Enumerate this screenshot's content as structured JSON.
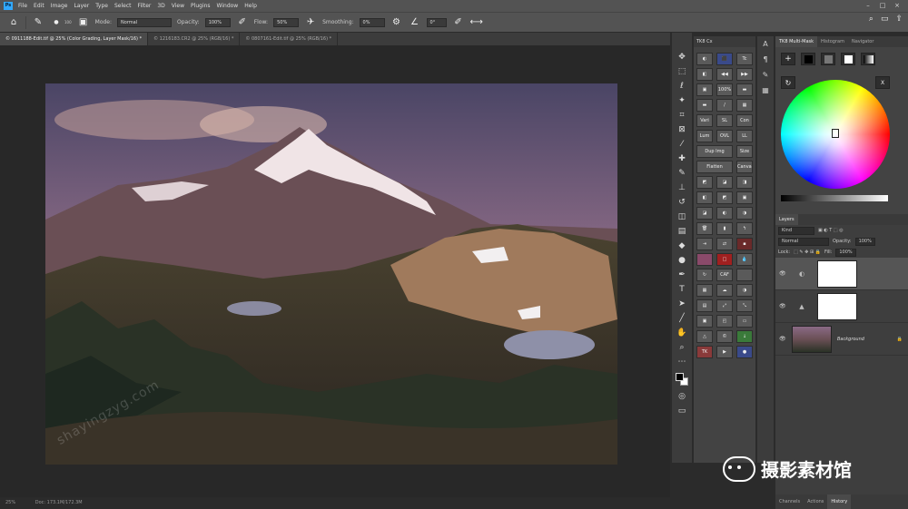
{
  "app": {
    "name": "Ps",
    "menu": [
      "File",
      "Edit",
      "Image",
      "Layer",
      "Type",
      "Select",
      "Filter",
      "3D",
      "View",
      "Plugins",
      "Window",
      "Help"
    ]
  },
  "options": {
    "mode_label": "Mode:",
    "mode_value": "Normal",
    "opacity_label": "Opacity:",
    "opacity_value": "100%",
    "flow_label": "Flow:",
    "flow_value": "50%",
    "smoothing_label": "Smoothing:",
    "smoothing_value": "0%",
    "angle_value": "0°",
    "brush_size": "100"
  },
  "tabs": [
    {
      "label": "© 0911188-Edit.tif @ 25% (Color Grading, Layer Mask/16) *",
      "active": true
    },
    {
      "label": "© 1216183.CR2 @ 25% (RGB/16) *",
      "active": false
    },
    {
      "label": "© 0807161-Edit.tif @ 25% (RGB/16) *",
      "active": false
    }
  ],
  "status": {
    "zoom": "25%",
    "doc": "Doc: 173.1M/172.3M"
  },
  "txpanel": {
    "title": "TK8 Cx",
    "buttons": [
      "",
      "",
      "",
      "",
      "",
      "",
      "",
      "100%",
      "",
      "",
      "",
      "",
      "Vari",
      "SL",
      "Con",
      "Lum",
      "OVL",
      "LL",
      "Mid",
      "",
      "",
      "",
      "",
      "",
      "",
      "",
      "",
      "",
      "",
      "",
      "",
      "",
      "",
      "",
      "",
      "",
      "",
      "",
      "",
      "",
      "ACR",
      "CAF",
      "",
      "",
      "",
      "",
      "",
      "",
      "",
      "",
      ""
    ],
    "wide1": "Dup Img",
    "wide1b": "Size",
    "wide2": "Flatten",
    "wide2b": "Canvas"
  },
  "right": {
    "tab1": "TK8 Multi-Mask",
    "tab2": "Histogram",
    "tab3": "Navigator",
    "x_label": "X"
  },
  "layers": {
    "title": "Layers",
    "kind_label": "Kind",
    "blend": "Normal",
    "opacity_label": "Opacity:",
    "opacity_value": "100%",
    "lock_label": "Lock:",
    "fill_label": "Fill:",
    "fill_value": "100%",
    "items": [
      {
        "name": ""
      },
      {
        "name": ""
      },
      {
        "name": "Background"
      }
    ]
  },
  "bottom_tabs": [
    "Channels",
    "Actions",
    "History"
  ],
  "watermark": {
    "text": "摄影素材馆",
    "diag": "shayingzyg.com"
  }
}
